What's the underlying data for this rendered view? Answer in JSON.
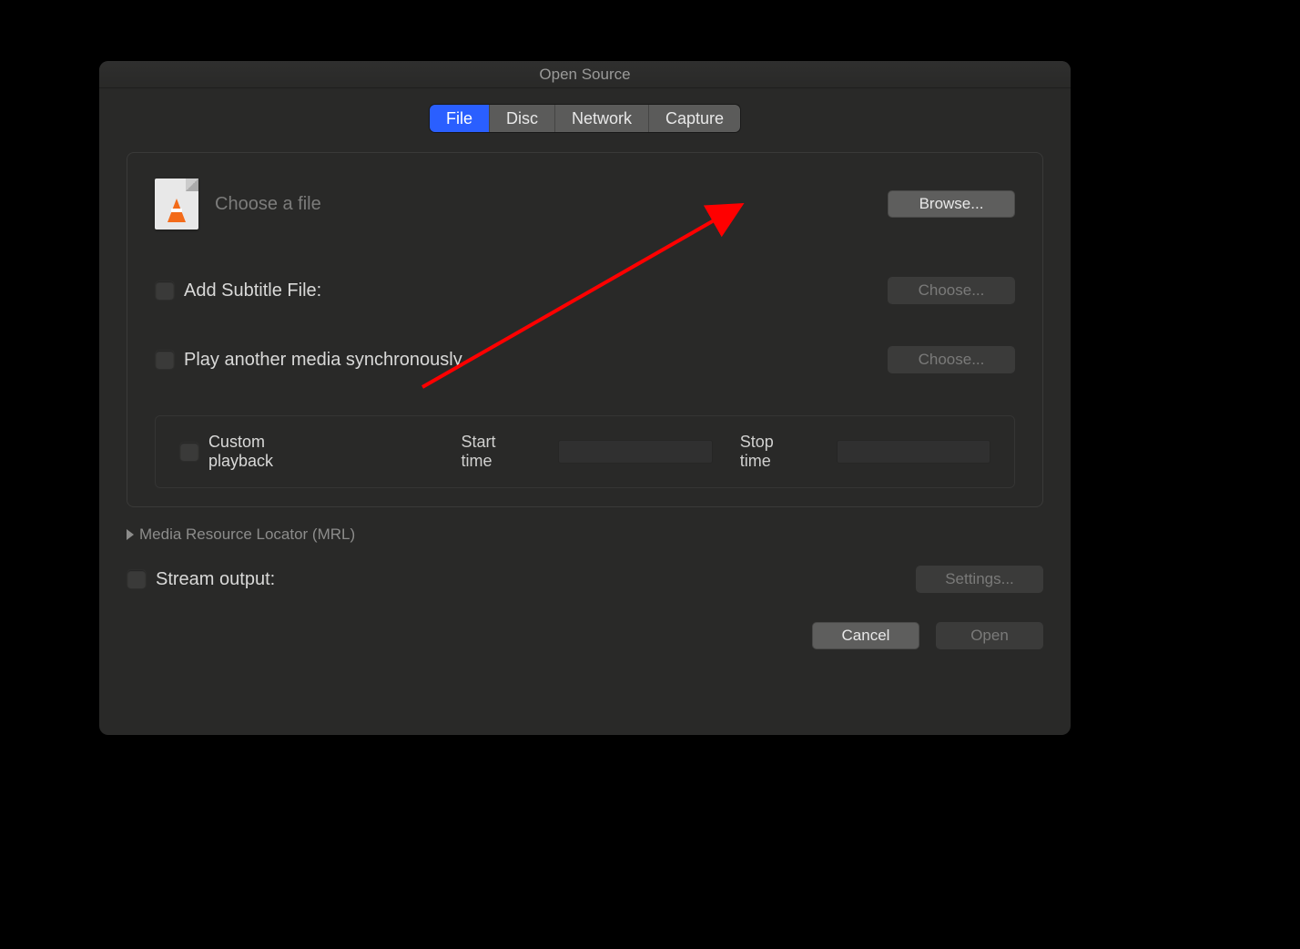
{
  "window": {
    "title": "Open Source"
  },
  "tabs": {
    "items": [
      "File",
      "Disc",
      "Network",
      "Capture"
    ],
    "active_index": 0
  },
  "file_section": {
    "placeholder": "Choose a file",
    "browse_label": "Browse..."
  },
  "subtitle_option": {
    "label": "Add Subtitle File:",
    "choose_label": "Choose...",
    "checked": false
  },
  "sync_option": {
    "label": "Play another media synchronously",
    "choose_label": "Choose...",
    "checked": false
  },
  "custom_playback": {
    "label": "Custom playback",
    "start_label": "Start time",
    "stop_label": "Stop time",
    "start_value": "",
    "stop_value": "",
    "checked": false
  },
  "mrl": {
    "label": "Media Resource Locator (MRL)"
  },
  "stream_output": {
    "label": "Stream output:",
    "settings_label": "Settings...",
    "checked": false
  },
  "footer": {
    "cancel_label": "Cancel",
    "open_label": "Open"
  },
  "annotation": {
    "arrow_color": "#ff0000"
  }
}
